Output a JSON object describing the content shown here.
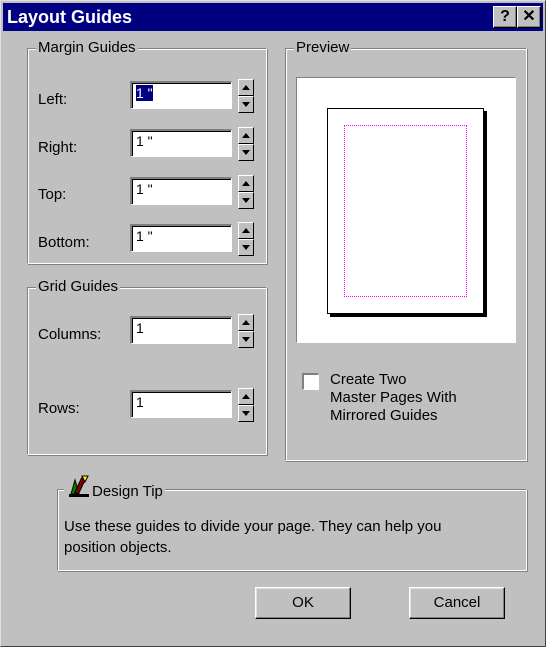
{
  "window": {
    "title": "Layout Guides",
    "help_label": "?",
    "close_label": "✕"
  },
  "margin_guides": {
    "legend": "Margin Guides",
    "left": {
      "label": "Left:",
      "value": "1 \""
    },
    "right": {
      "label": "Right:",
      "value": "1 \""
    },
    "top": {
      "label": "Top:",
      "value": "1 \""
    },
    "bottom": {
      "label": "Bottom:",
      "value": "1 \""
    }
  },
  "grid_guides": {
    "legend": "Grid Guides",
    "columns": {
      "label": "Columns:",
      "value": "1"
    },
    "rows": {
      "label": "Rows:",
      "value": "1"
    }
  },
  "preview": {
    "legend": "Preview",
    "checkbox_label_line1": "Create Two",
    "checkbox_label_line2": "Master Pages With",
    "checkbox_label_line3": "Mirrored Guides",
    "checkbox_checked": false
  },
  "design_tip": {
    "legend": "Design Tip",
    "text_line1": "Use these guides to divide your page.  They can help you",
    "text_line2": "position objects."
  },
  "buttons": {
    "ok": "OK",
    "cancel": "Cancel"
  },
  "colors": {
    "face": "#c0c0c0",
    "title_bar": "#000080",
    "guides": "#ff00ff"
  }
}
